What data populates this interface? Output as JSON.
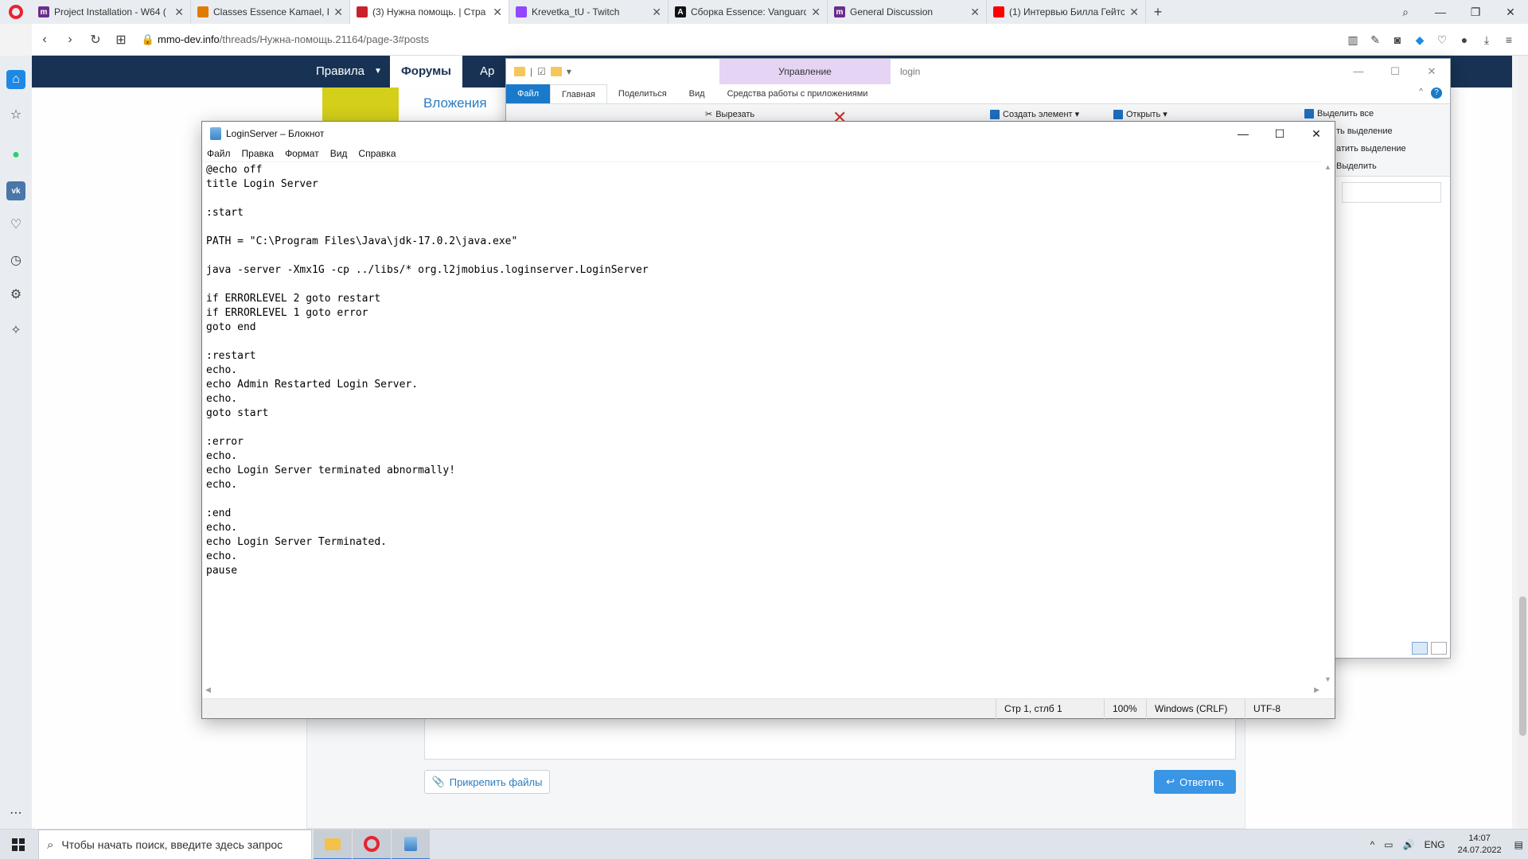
{
  "browser": {
    "tabs": [
      {
        "title": "Project Installation - W64 (",
        "fav_color": "#6b2d8c",
        "fav_letter": "m",
        "active": false
      },
      {
        "title": "Classes Essence Kamael, Ре",
        "fav_color": "#e07b00",
        "fav_letter": "",
        "active": false
      },
      {
        "title": "(3) Нужна помощь. | Стра",
        "fav_color": "#c8232c",
        "fav_letter": "",
        "active": true
      },
      {
        "title": "Krevetka_tU - Twitch",
        "fav_color": "#9146ff",
        "fav_letter": "",
        "active": false
      },
      {
        "title": "Сборка Essence: Vanguard",
        "fav_color": "#111111",
        "fav_letter": "A",
        "active": false
      },
      {
        "title": "General Discussion",
        "fav_color": "#6b2d8c",
        "fav_letter": "m",
        "active": false
      },
      {
        "title": "(1) Интервью Билла Гейтс",
        "fav_color": "#ff0000",
        "fav_letter": "",
        "active": false
      }
    ],
    "new_tab_symbol": "+",
    "url_host": "mmo-dev.info",
    "url_path": "/threads/Нужна-помощь.21164/page-3#posts"
  },
  "site": {
    "nav_rules": "Правила",
    "nav_forums": "Форумы",
    "nav_partial": "Ар",
    "attachments_heading": "Вложения",
    "attach_files_label": "Прикрепить файлы",
    "reply_label": "Ответить"
  },
  "explorer": {
    "manage_tab": "Управление",
    "window_name": "login",
    "ribbon_tabs": [
      "Файл",
      "Главная",
      "Поделиться",
      "Вид",
      "Средства работы с приложениями"
    ],
    "ribbon_items": {
      "cut": "Вырезать",
      "create_item": "Создать элемент ▾",
      "open": "Открыть ▾",
      "select_all": "Выделить все",
      "deselect": "ть выделение",
      "invert": "атить выделение",
      "select": "Выделить"
    }
  },
  "notepad": {
    "title": "LoginServer – Блокнот",
    "menu": [
      "Файл",
      "Правка",
      "Формат",
      "Вид",
      "Справка"
    ],
    "content": "@echo off\ntitle Login Server\n\n:start\n\nPATH = \"C:\\Program Files\\Java\\jdk-17.0.2\\java.exe\"\n\njava -server -Xmx1G -cp ../libs/* org.l2jmobius.loginserver.LoginServer\n\nif ERRORLEVEL 2 goto restart\nif ERRORLEVEL 1 goto error\ngoto end\n\n:restart\necho.\necho Admin Restarted Login Server.\necho.\ngoto start\n\n:error\necho.\necho Login Server terminated abnormally!\necho.\n\n:end\necho.\necho Login Server Terminated.\necho.\npause",
    "status": {
      "position": "Стр 1, стлб 1",
      "zoom": "100%",
      "line_ending": "Windows (CRLF)",
      "encoding": "UTF-8"
    }
  },
  "taskbar": {
    "search_placeholder": "Чтобы начать поиск, введите здесь запрос",
    "lang": "ENG",
    "time": "14:07",
    "date": "24.07.2022"
  }
}
